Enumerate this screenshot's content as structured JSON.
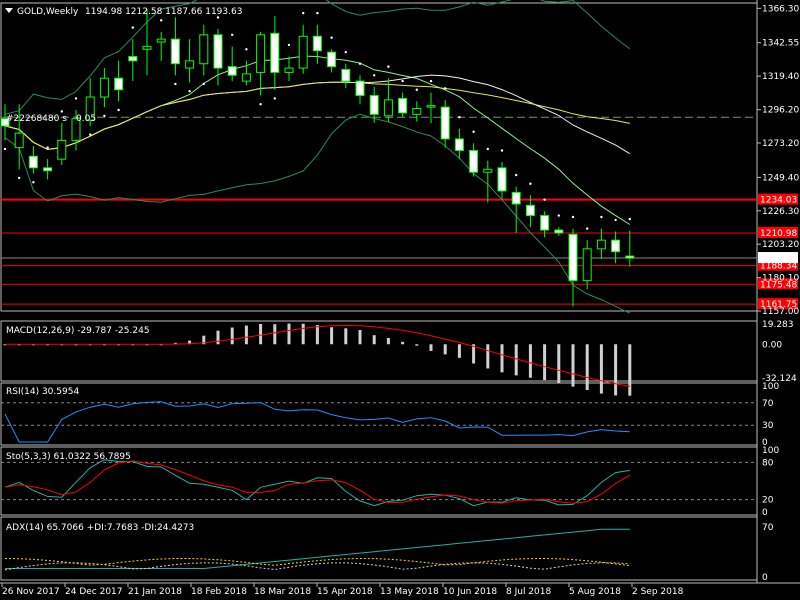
{
  "header": {
    "symbol": "GOLD,Weekly",
    "ohlc": "1194.98 1212.58 1187.66 1193.63",
    "note": "#22268480 s",
    "note_val": "0.05"
  },
  "price_axis": {
    "ticks": [
      "1366.30",
      "1342.55",
      "1319.40",
      "1296.20",
      "1273.20",
      "1249.40",
      "1226.30",
      "1203.20",
      "1180.10",
      "1157.00"
    ],
    "ymax": 1370,
    "ymin": 1157
  },
  "h_lines": [
    {
      "label": "1234.03",
      "value": 1234.03,
      "color": "#ff0000"
    },
    {
      "label": "1210.98",
      "value": 1210.98,
      "color": "#ff0000"
    },
    {
      "label": "1188.34",
      "value": 1188.34,
      "color": "#ff0000"
    },
    {
      "label": "1175.48",
      "value": 1175.48,
      "color": "#ff0000"
    },
    {
      "label": "1161.75",
      "value": 1161.75,
      "color": "#ff0000"
    }
  ],
  "current_price": {
    "label": "1193.63",
    "value": 1193.63
  },
  "dash_level": 1291,
  "chart_data": {
    "type": "candlestick",
    "x_ticks": [
      "26 Nov 2017",
      "24 Dec 2017",
      "21 Jan 2018",
      "18 Feb 2018",
      "18 Mar 2018",
      "15 Apr 2018",
      "13 May 2018",
      "10 Jun 2018",
      "8 Jul 2018",
      "5 Aug 2018",
      "2 Sep 2018"
    ],
    "ohlc": [
      [
        1290,
        1300,
        1275,
        1285
      ],
      [
        1270,
        1300,
        1255,
        1280
      ],
      [
        1264,
        1271,
        1252,
        1256
      ],
      [
        1256,
        1262,
        1248,
        1254
      ],
      [
        1262,
        1287,
        1258,
        1275
      ],
      [
        1275,
        1296,
        1268,
        1290
      ],
      [
        1289,
        1318,
        1285,
        1305
      ],
      [
        1305,
        1325,
        1298,
        1318
      ],
      [
        1318,
        1330,
        1302,
        1310
      ],
      [
        1333,
        1345,
        1316,
        1330
      ],
      [
        1338,
        1366,
        1320,
        1340
      ],
      [
        1343,
        1350,
        1330,
        1345
      ],
      [
        1345,
        1360,
        1320,
        1328
      ],
      [
        1325,
        1345,
        1315,
        1330
      ],
      [
        1328,
        1355,
        1320,
        1348
      ],
      [
        1348,
        1352,
        1313,
        1325
      ],
      [
        1326,
        1340,
        1316,
        1320
      ],
      [
        1316,
        1330,
        1313,
        1321
      ],
      [
        1322,
        1350,
        1306,
        1348
      ],
      [
        1349,
        1361,
        1310,
        1322
      ],
      [
        1322,
        1333,
        1316,
        1325
      ],
      [
        1325,
        1355,
        1321,
        1347
      ],
      [
        1347,
        1355,
        1328,
        1337
      ],
      [
        1336,
        1338,
        1322,
        1326
      ],
      [
        1324,
        1328,
        1311,
        1316
      ],
      [
        1316,
        1320,
        1300,
        1306
      ],
      [
        1306,
        1312,
        1287,
        1293
      ],
      [
        1292,
        1318,
        1288,
        1303
      ],
      [
        1304,
        1308,
        1291,
        1294
      ],
      [
        1293,
        1302,
        1288,
        1297
      ],
      [
        1298,
        1308,
        1287,
        1299
      ],
      [
        1298,
        1303,
        1270,
        1276
      ],
      [
        1276,
        1283,
        1262,
        1268
      ],
      [
        1268,
        1273,
        1250,
        1253
      ],
      [
        1253,
        1261,
        1232,
        1255
      ],
      [
        1256,
        1260,
        1234,
        1240
      ],
      [
        1239,
        1243,
        1211,
        1231
      ],
      [
        1230,
        1237,
        1215,
        1223
      ],
      [
        1223,
        1226,
        1208,
        1213
      ],
      [
        1213,
        1215,
        1209,
        1211
      ],
      [
        1210,
        1214,
        1160,
        1178
      ],
      [
        1178,
        1206,
        1172,
        1200
      ],
      [
        1200,
        1214,
        1193,
        1206
      ],
      [
        1206,
        1212,
        1190,
        1198
      ],
      [
        1194.98,
        1212.58,
        1187.66,
        1193.63
      ]
    ],
    "indicators": {
      "macd": {
        "label": "MACD(12,26,9) -29.787 -25.245",
        "ticks": [
          "19.283",
          "0.00",
          "-32.124"
        ],
        "min": -32.124,
        "max": 19.283
      },
      "rsi": {
        "label": "RSI(14) 30.5954",
        "ticks": [
          "100",
          "70",
          "30",
          "0"
        ],
        "min": 0,
        "max": 100,
        "levels": [
          70,
          30
        ]
      },
      "sto": {
        "label": "Sto(5,3,3) 61.0322 56.7895",
        "ticks": [
          "100",
          "80",
          "20",
          "0"
        ],
        "min": 0,
        "max": 100,
        "levels": [
          80,
          20
        ]
      },
      "adx": {
        "label": "ADX(14) 65.7066 +DI:7.7683 -DI:24.4273",
        "ticks": [
          "70",
          "0"
        ],
        "min": 0,
        "max": 80
      }
    }
  }
}
